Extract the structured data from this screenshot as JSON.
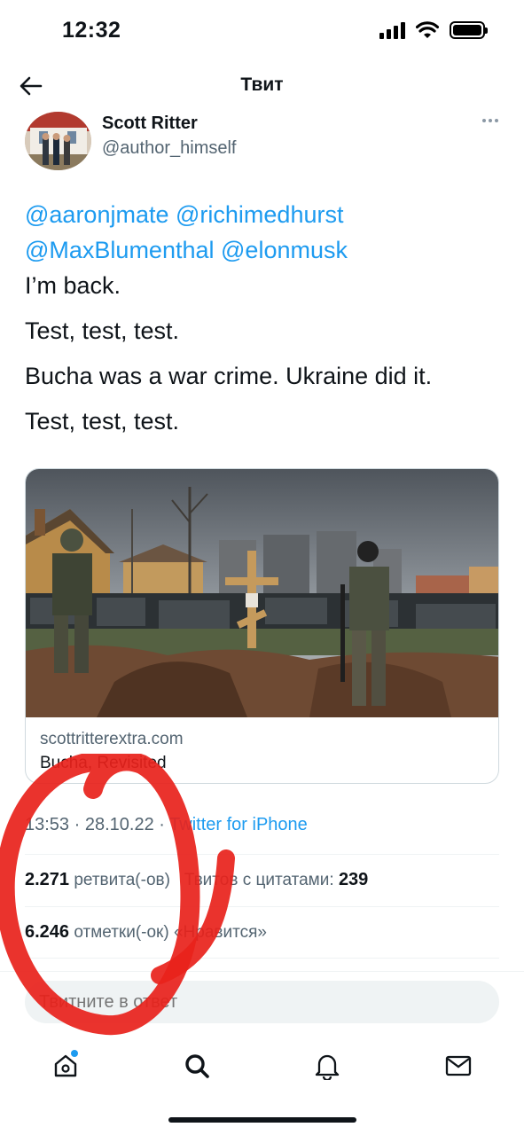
{
  "status_bar": {
    "time": "12:32"
  },
  "header": {
    "title": "Твит"
  },
  "author": {
    "name": "Scott Ritter",
    "handle": "@author_himself"
  },
  "tweet": {
    "mentions": [
      "@aaronjmate",
      "@richimedhurst",
      "@MaxBlumenthal",
      "@elonmusk"
    ],
    "lines": [
      "I’m back.",
      "Test, test, test.",
      "Bucha was a war crime. Ukraine did it.",
      "Test, test, test."
    ]
  },
  "link_card": {
    "domain": "scottritterextra.com",
    "title": "Bucha, Revisited"
  },
  "meta": {
    "time": "13:53",
    "separator": "·",
    "date": "28.10.22",
    "source": "Twitter for iPhone"
  },
  "stats": {
    "retweets_count": "2.271",
    "retweets_label": "ретвита(-ов)",
    "quotes_label": "Твитов с цитатами:",
    "quotes_count": "239",
    "likes_count": "6.246",
    "likes_label": "отметки(-ок) «Нравится»"
  },
  "reply": {
    "placeholder": "Твитните в ответ"
  },
  "tab_bar": {
    "items": [
      "home-icon",
      "search-icon",
      "bell-icon",
      "mail-icon"
    ]
  },
  "colors": {
    "accent": "#1d9bf0",
    "annotation": "#e8221b"
  }
}
